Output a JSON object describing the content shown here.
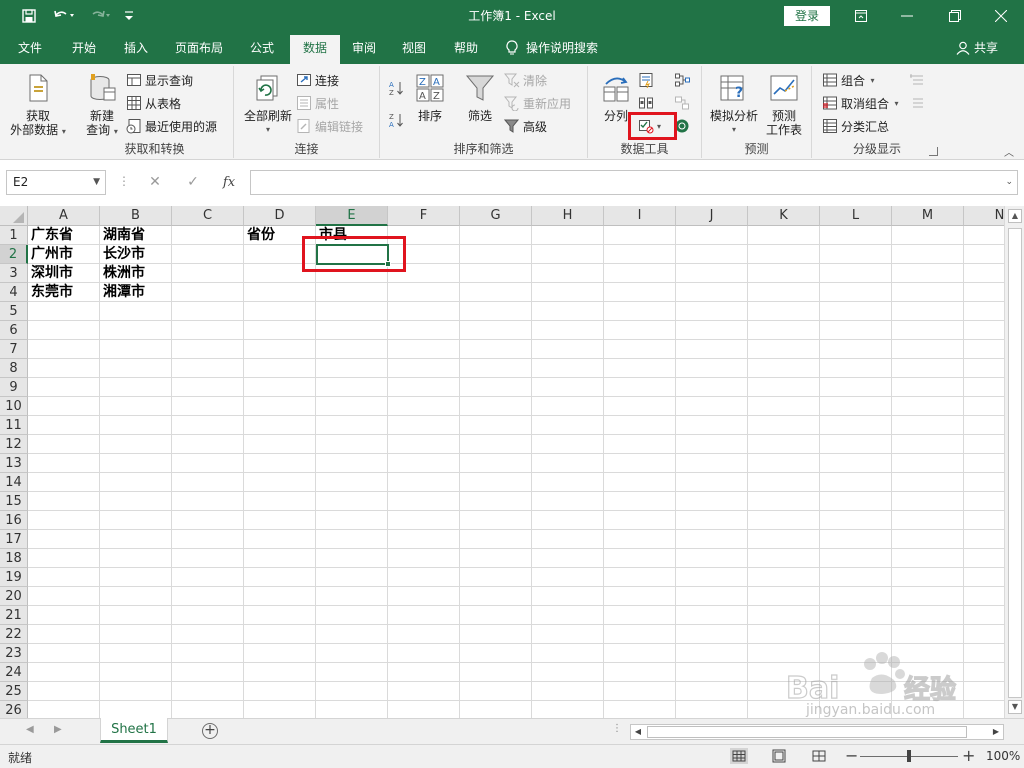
{
  "title_bar": {
    "window_title": "工作簿1  -  Excel",
    "login_label": "登录",
    "qat": [
      "save-icon",
      "undo-icon",
      "redo-icon",
      "customize-icon"
    ]
  },
  "tabs": [
    {
      "label": "文件",
      "active": false
    },
    {
      "label": "开始",
      "active": false
    },
    {
      "label": "插入",
      "active": false
    },
    {
      "label": "页面布局",
      "active": false
    },
    {
      "label": "公式",
      "active": false
    },
    {
      "label": "数据",
      "active": true
    },
    {
      "label": "审阅",
      "active": false
    },
    {
      "label": "视图",
      "active": false
    },
    {
      "label": "帮助",
      "active": false
    }
  ],
  "tell_me": "操作说明搜索",
  "share": "共享",
  "ribbon": {
    "get_transform": {
      "label": "获取和转换",
      "get_external_line1": "获取",
      "get_external_line2": "外部数据",
      "new_query_line1": "新建",
      "new_query_line2": "查询",
      "show_queries": "显示查询",
      "from_table": "从表格",
      "recent_sources": "最近使用的源"
    },
    "connections": {
      "label": "连接",
      "refresh_all": "全部刷新",
      "connections": "连接",
      "properties": "属性",
      "edit_links": "编辑链接"
    },
    "sort_filter": {
      "label": "排序和筛选",
      "sort": "排序",
      "filter": "筛选",
      "clear": "清除",
      "reapply": "重新应用",
      "advanced": "高级"
    },
    "data_tools": {
      "label": "数据工具",
      "text_to_columns": "分列"
    },
    "forecast": {
      "label": "预测",
      "what_if": "模拟分析",
      "forecast_sheet_line1": "预测",
      "forecast_sheet_line2": "工作表"
    },
    "outline": {
      "label": "分级显示",
      "group": "组合",
      "ungroup": "取消组合",
      "subtotal": "分类汇总"
    }
  },
  "formula_bar": {
    "name_box": "E2",
    "fx": "fx",
    "content": ""
  },
  "grid": {
    "columns": [
      "A",
      "B",
      "C",
      "D",
      "E",
      "F",
      "G",
      "H",
      "I",
      "J",
      "K",
      "L",
      "M",
      "N"
    ],
    "rows": [
      "1",
      "2",
      "3",
      "4",
      "5",
      "6",
      "7",
      "8",
      "9",
      "10",
      "11",
      "12",
      "13",
      "14",
      "15",
      "16",
      "17",
      "18",
      "19",
      "20",
      "21",
      "22",
      "23",
      "24",
      "25",
      "26"
    ],
    "selected_col": "E",
    "selected_row": "2",
    "cells": [
      {
        "ref": "A1",
        "value": "广东省"
      },
      {
        "ref": "B1",
        "value": "湖南省"
      },
      {
        "ref": "D1",
        "value": "省份"
      },
      {
        "ref": "E1",
        "value": "市县"
      },
      {
        "ref": "A2",
        "value": "广州市"
      },
      {
        "ref": "B2",
        "value": "长沙市"
      },
      {
        "ref": "A3",
        "value": "深圳市"
      },
      {
        "ref": "B3",
        "value": "株洲市"
      },
      {
        "ref": "A4",
        "value": "东莞市"
      },
      {
        "ref": "B4",
        "value": "湘潭市"
      }
    ]
  },
  "sheets": [
    {
      "label": "Sheet1",
      "active": true
    }
  ],
  "status": {
    "text": "就绪",
    "zoom": "100%",
    "zoom_fraction": 0.5
  },
  "watermark": {
    "text": "jingyan.baidu.com"
  },
  "colors": {
    "brand": "#217346",
    "highlight": "#e0141e"
  }
}
